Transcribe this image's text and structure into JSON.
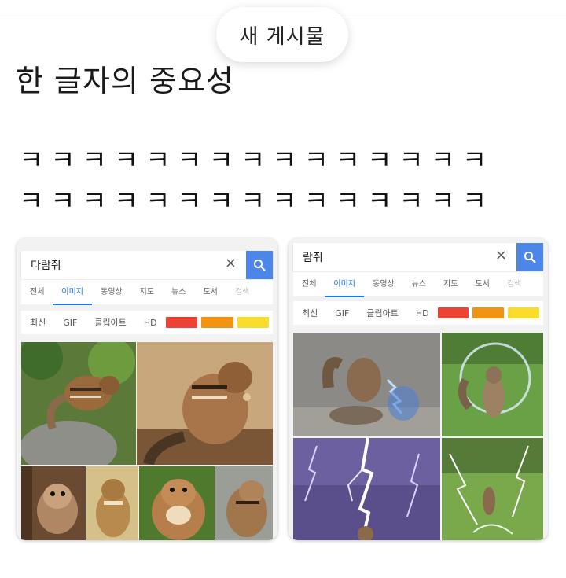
{
  "toast": {
    "label": "새 게시물"
  },
  "post": {
    "title": "한 글자의 중요성",
    "line1": "ㅋㅋㅋㅋㅋㅋㅋㅋㅋㅋㅋㅋㅋㅋㅋ",
    "line2": "ㅋㅋㅋㅋㅋㅋㅋㅋㅋㅋㅋㅋㅋㅋㅋ"
  },
  "left_search": {
    "query": "다람쥐",
    "clear": "×",
    "tabs": [
      "전체",
      "이미지",
      "동영상",
      "지도",
      "뉴스",
      "도서",
      "검색"
    ],
    "filters": [
      "최신",
      "GIF",
      "클립아트",
      "HD"
    ],
    "swatches": [
      "#ec4335",
      "#f39312",
      "#fadc2c"
    ]
  },
  "right_search": {
    "query": "람쥐",
    "clear": "×",
    "tabs": [
      "전체",
      "이미지",
      "동영상",
      "뉴스",
      "지도",
      "도서",
      "검색"
    ],
    "filters": [
      "최신",
      "GIF",
      "클립아트",
      "HD"
    ],
    "swatches": [
      "#ec4335",
      "#f39312",
      "#fadc2c"
    ]
  },
  "colors": {
    "accent": "#4c86e8",
    "active_tab": "#1a73e8"
  }
}
